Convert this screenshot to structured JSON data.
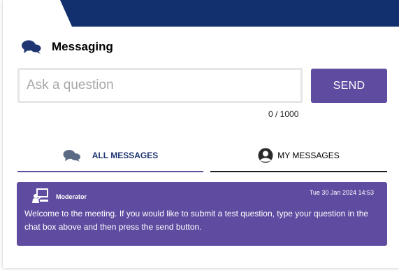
{
  "messaging": {
    "title": "Messaging",
    "input": {
      "placeholder": "Ask a question",
      "value": ""
    },
    "send_label": "SEND",
    "char_count": "0 / 1000",
    "tabs": [
      {
        "label": "ALL MESSAGES",
        "icon": "chat-bubbles-icon",
        "active": true
      },
      {
        "label": "MY MESSAGES",
        "icon": "user-avatar-icon",
        "active": false
      }
    ],
    "messages": [
      {
        "author": "Moderator",
        "timestamp": "Tue 30 Jan 2024 14:53",
        "icon": "presenter-icon",
        "text": "Welcome to the meeting. If you would like to submit a test question, type your question in the chat box above and then press the send button."
      }
    ]
  },
  "colors": {
    "banner": "#13306e",
    "accent": "#5f4ba0",
    "icon_navy": "#1f3672",
    "icon_grey": "#5b6b86"
  }
}
